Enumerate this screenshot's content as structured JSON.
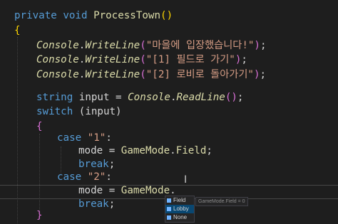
{
  "code": {
    "l1_kw1": "private",
    "l1_kw2": "void",
    "l1_name": "ProcessTown",
    "l2": "{",
    "console": "Console",
    "writeline": "WriteLine",
    "msg1": "\"마을에 입장했습니다!\"",
    "msg2": "\"[1] 필드로 가기\"",
    "msg3": "\"[2] 로비로 돌아가기\"",
    "kw_string": "string",
    "var_input": "input",
    "readline": "ReadLine",
    "kw_switch": "switch",
    "switch_arg": "(input)",
    "brace_open": "{",
    "brace_close": "}",
    "kw_case": "case",
    "case1": "\"1\"",
    "case2": "\"2\"",
    "var_mode": "mode",
    "enum_type": "GameMode",
    "enum_field": "Field",
    "kw_break": "break"
  },
  "intellisense": {
    "items": [
      "Field",
      "Lobby",
      "None"
    ],
    "selected": "Lobby",
    "tooltip": "GameMode.Field = 0"
  },
  "colors": {
    "background": "#1e1e1e",
    "keyword": "#569cd6",
    "method": "#dcdcaa",
    "string": "#d69d85",
    "bracket": "#ffd700",
    "selection": "#094771"
  }
}
